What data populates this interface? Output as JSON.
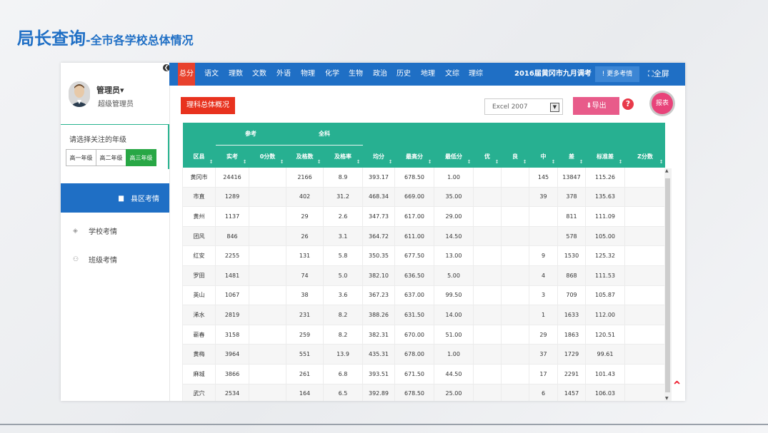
{
  "page": {
    "title_main": "局长查询",
    "title_sub": "-全市各学校总体情况"
  },
  "sidebar": {
    "user_name": "管理员",
    "user_caret": "▾",
    "user_role": "超级管理员",
    "grade_label": "请选择关注的年级",
    "grades": [
      "高一年级",
      "高二年级",
      "高三年级"
    ],
    "nav": [
      "县区考情",
      "学校考情",
      "班级考情"
    ]
  },
  "topbar": {
    "tabs": [
      "总分",
      "语文",
      "理数",
      "文数",
      "外语",
      "物理",
      "化学",
      "生物",
      "政治",
      "历史",
      "地理",
      "文综",
      "理综"
    ],
    "exam_name": "2016届黄冈市九月调考",
    "more": "! 更多考情",
    "fullscreen": "⛶全屏"
  },
  "toolbar": {
    "overview": "理科总体概况",
    "format": "Excel 2007",
    "export": "⬇导出",
    "help": "?",
    "report": "报表"
  },
  "table": {
    "group_headers": {
      "canzhi": "参考",
      "quanke": "全科"
    },
    "columns": [
      "区县",
      "实考",
      "0分数",
      "及格数",
      "及格率",
      "均分",
      "最高分",
      "最低分",
      "优",
      "良",
      "中",
      "差",
      "标准差",
      "Z分数"
    ],
    "rows": [
      [
        "黄冈市",
        "24416",
        "",
        "2166",
        "8.9",
        "393.17",
        "678.50",
        "1.00",
        "",
        "",
        "145",
        "13847",
        "115.26",
        ""
      ],
      [
        "市直",
        "1289",
        "",
        "402",
        "31.2",
        "468.34",
        "669.00",
        "35.00",
        "",
        "",
        "39",
        "378",
        "135.63",
        ""
      ],
      [
        "黄州",
        "1137",
        "",
        "29",
        "2.6",
        "347.73",
        "617.00",
        "29.00",
        "",
        "",
        "",
        "811",
        "111.09",
        ""
      ],
      [
        "团风",
        "846",
        "",
        "26",
        "3.1",
        "364.72",
        "611.00",
        "14.50",
        "",
        "",
        "",
        "578",
        "105.00",
        ""
      ],
      [
        "红安",
        "2255",
        "",
        "131",
        "5.8",
        "350.35",
        "677.50",
        "13.00",
        "",
        "",
        "9",
        "1530",
        "125.32",
        ""
      ],
      [
        "罗田",
        "1481",
        "",
        "74",
        "5.0",
        "382.10",
        "636.50",
        "5.00",
        "",
        "",
        "4",
        "868",
        "111.53",
        ""
      ],
      [
        "英山",
        "1067",
        "",
        "38",
        "3.6",
        "367.23",
        "637.00",
        "99.50",
        "",
        "",
        "3",
        "709",
        "105.87",
        ""
      ],
      [
        "浠水",
        "2819",
        "",
        "231",
        "8.2",
        "388.26",
        "631.50",
        "14.00",
        "",
        "",
        "1",
        "1633",
        "112.00",
        ""
      ],
      [
        "蕲春",
        "3158",
        "",
        "259",
        "8.2",
        "382.31",
        "670.00",
        "51.00",
        "",
        "",
        "29",
        "1863",
        "120.51",
        ""
      ],
      [
        "黄梅",
        "3964",
        "",
        "551",
        "13.9",
        "435.31",
        "678.00",
        "1.00",
        "",
        "",
        "37",
        "1729",
        "99.61",
        ""
      ],
      [
        "麻城",
        "3866",
        "",
        "261",
        "6.8",
        "393.51",
        "671.50",
        "44.50",
        "",
        "",
        "17",
        "2291",
        "101.43",
        ""
      ],
      [
        "武穴",
        "2534",
        "",
        "164",
        "6.5",
        "392.89",
        "678.50",
        "25.00",
        "",
        "",
        "6",
        "1457",
        "106.03",
        ""
      ]
    ]
  },
  "colors": {
    "primary": "#1f6fc5",
    "active_tab": "#e8412d",
    "table_header": "#27b091",
    "grade_active": "#28a745",
    "export": "#e85b8a"
  }
}
